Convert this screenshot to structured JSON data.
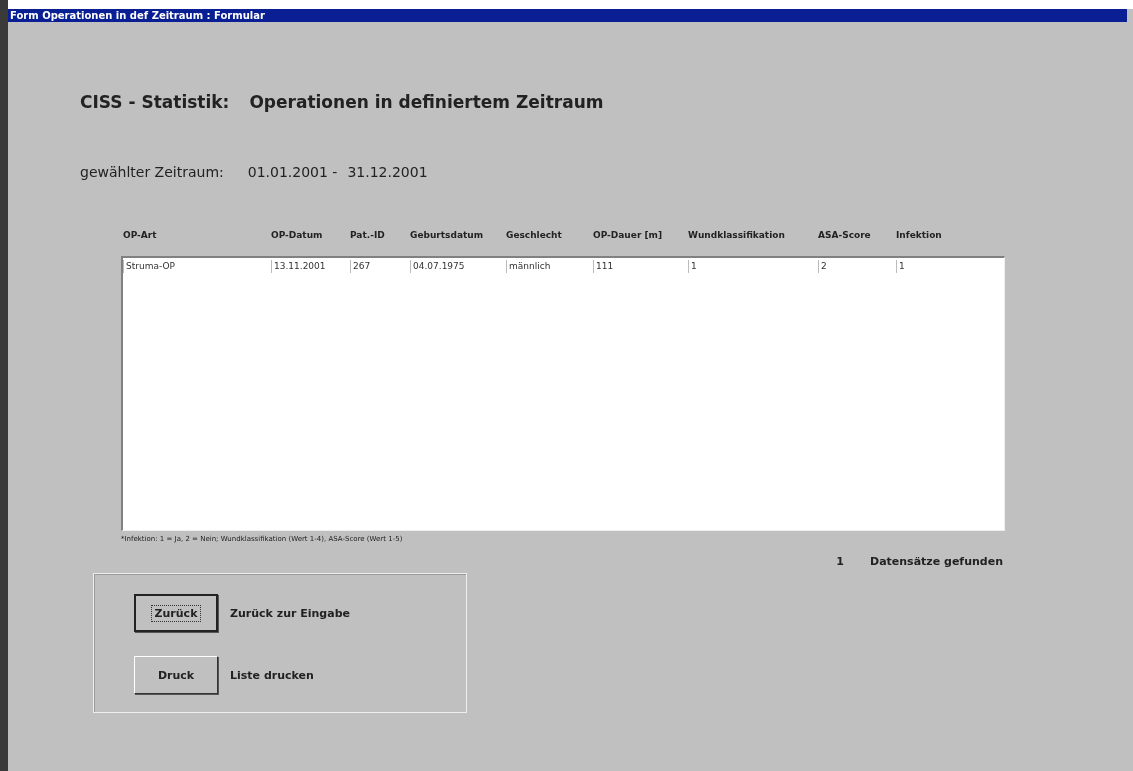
{
  "window": {
    "title": "Form Operationen in def Zeitraum : Formular"
  },
  "heading": {
    "label": "CISS - Statistik:",
    "text": "Operationen in definiertem Zeitraum"
  },
  "period": {
    "label": "gewählter Zeitraum:",
    "from": "01.01.2001 -",
    "to": "31.12.2001"
  },
  "table": {
    "columns": [
      "OP-Art",
      "OP-Datum",
      "Pat.-ID",
      "Geburtsdatum",
      "Geschlecht",
      "OP-Dauer [m]",
      "Wundklassifikation",
      "ASA-Score",
      "Infektion"
    ],
    "rows": [
      [
        "Struma-OP",
        "13.11.2001",
        "267",
        "04.07.1975",
        "männlich",
        "111",
        "1",
        "2",
        "1"
      ]
    ]
  },
  "footnote": "*Infektion: 1 = Ja, 2  = Nein; Wundklassifikation (Wert 1-4), ASA-Score (Wert 1-5)",
  "count": {
    "value": "1",
    "label": "Datensätze gefunden"
  },
  "actions": [
    {
      "button": "Zurück",
      "description": "Zurück zur Eingabe",
      "focused": true
    },
    {
      "button": "Druck",
      "description": "Liste drucken",
      "focused": false
    }
  ]
}
